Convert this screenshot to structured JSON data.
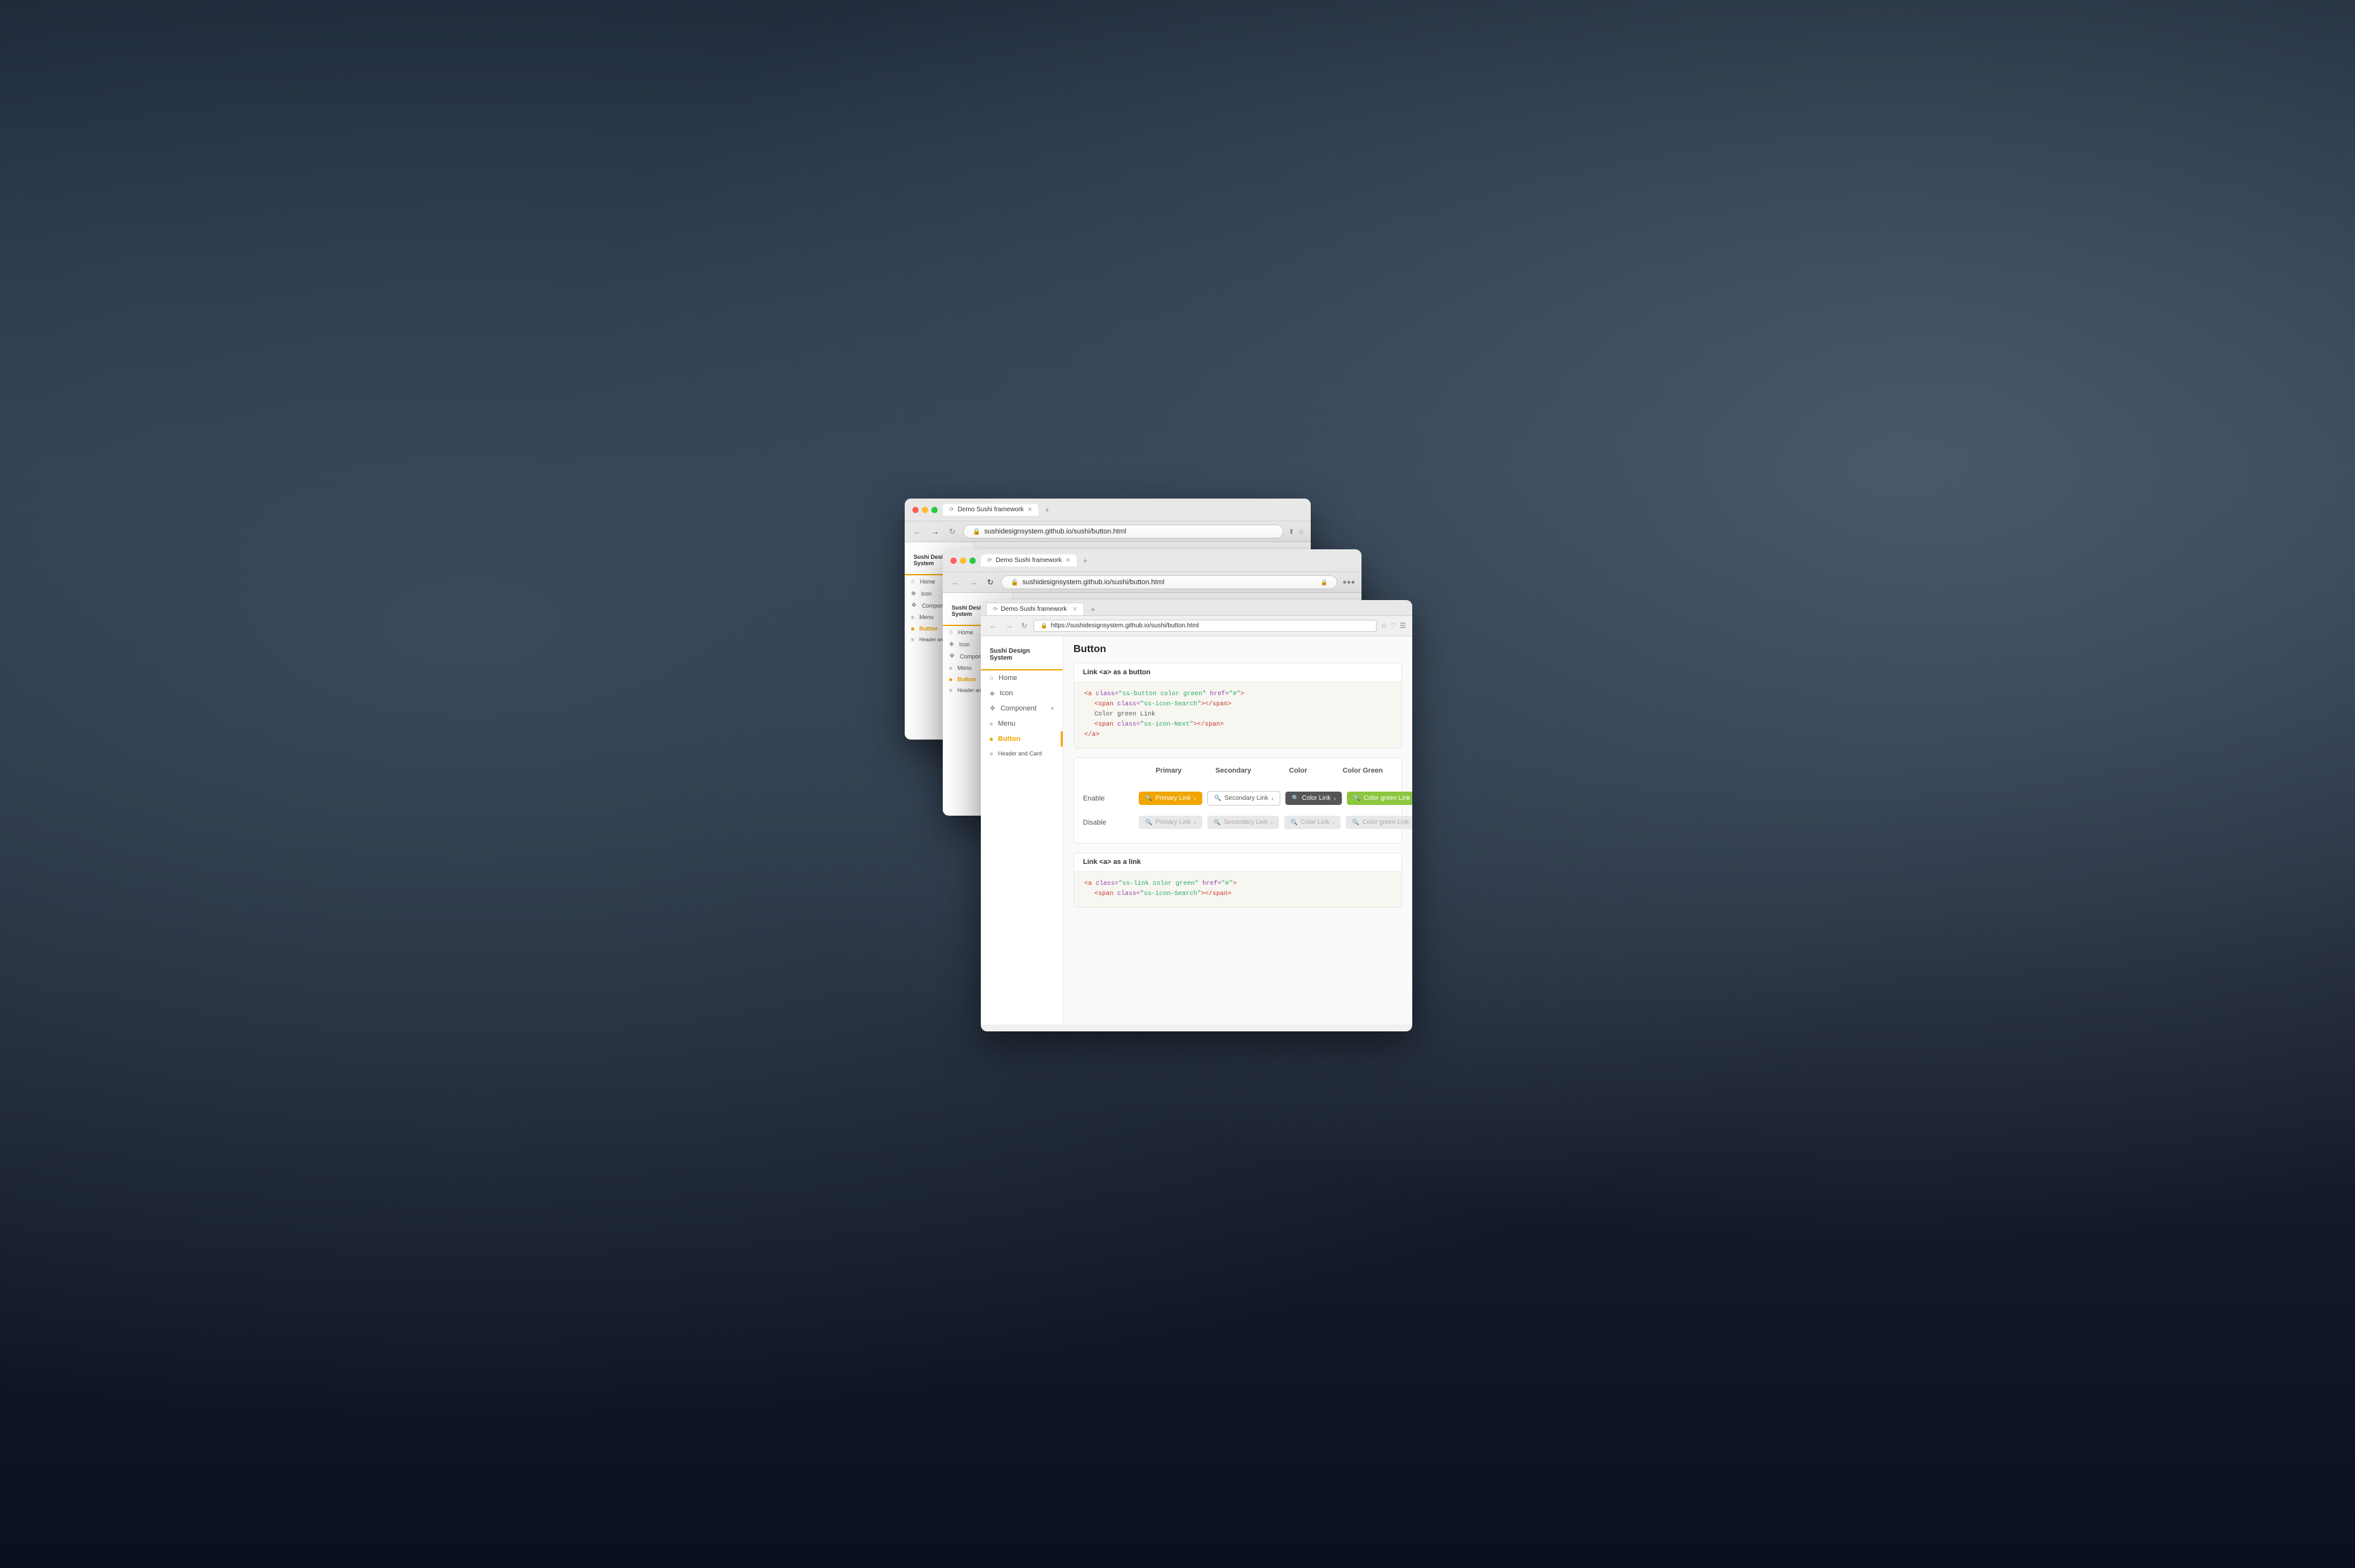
{
  "app": {
    "title": "Sushi Design System",
    "url_short": "sushidesignsystem.github.io/sushi/button.html",
    "url_full": "https://sushidesignsystem.github.io/sushi/button.html"
  },
  "tabs": [
    {
      "label": "Demo Sushi framework",
      "active": true
    }
  ],
  "sidebar": {
    "brand": "Sushi Design System",
    "items": [
      {
        "id": "home",
        "label": "Home",
        "icon": "⌂",
        "type": "icon"
      },
      {
        "id": "icon",
        "label": "Icon",
        "icon": "◈",
        "type": "icon"
      },
      {
        "id": "component",
        "label": "Component",
        "icon": "❖",
        "type": "icon",
        "hasArrow": true
      },
      {
        "id": "menu",
        "label": "Menu",
        "type": "dot"
      },
      {
        "id": "button",
        "label": "Button",
        "type": "dot",
        "active": true
      },
      {
        "id": "header-card",
        "label": "Header and Card",
        "type": "dot"
      }
    ]
  },
  "page": {
    "title": "Button",
    "section1_title": "Link <a> as a button",
    "code1": [
      "<a class=\"ss-button color green\" href=\"#\">",
      "    <span class=\"ss-icon-Search\"></span>",
      "    Color green Link",
      "    <span class=\"ss-icon-Next\"></span>",
      "</a>"
    ],
    "table": {
      "headers": [
        "",
        "Primary",
        "Secondary",
        "Color",
        "Color Green"
      ],
      "rows": [
        {
          "label": "Enable",
          "cells": [
            {
              "text": "Primary Link",
              "variant": "primary",
              "disabled": false
            },
            {
              "text": "Secondary Link",
              "variant": "secondary",
              "disabled": false
            },
            {
              "text": "Color Link",
              "variant": "color",
              "disabled": false
            },
            {
              "text": "Color green Link",
              "variant": "color-green",
              "disabled": false
            }
          ]
        },
        {
          "label": "Disable",
          "cells": [
            {
              "text": "Primary Link",
              "variant": "primary",
              "disabled": true
            },
            {
              "text": "Secondary Link",
              "variant": "secondary",
              "disabled": true
            },
            {
              "text": "Color Link",
              "variant": "color",
              "disabled": true
            },
            {
              "text": "Color green Link",
              "variant": "color-green",
              "disabled": true
            }
          ]
        }
      ]
    },
    "section2_title": "Link <a> as a link",
    "code2": [
      "<a class=\"ss-link color green\" href=\"#\">",
      "    <span class=\"ss-icon-Search\"></span>"
    ]
  },
  "colors": {
    "brand": "#f0a500",
    "primary_btn": "#f0a500",
    "color_btn": "#555555",
    "color_green_btn": "#8dc63f",
    "disabled": "#e0e0e0"
  }
}
